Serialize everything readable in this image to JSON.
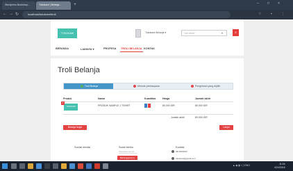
{
  "browser": {
    "tabs": [
      {
        "label": "Wordpress Bootstrap..."
      },
      {
        "label": "Tokokami | Belanja..."
      }
    ],
    "url": "localhost/tokokami/troli",
    "bookmarks": [
      "Apps",
      "Bookmarks"
    ]
  },
  "header": {
    "logo_text": "TOKOKAMI",
    "account_name": "Tokokami Belanja ▾",
    "search_placeholder": "Cari disini",
    "menu": [
      "BERANDA",
      "LAINNYA ▾",
      "PROFESA",
      "TROLI BELANJA",
      "KONTAK"
    ]
  },
  "cart": {
    "title": "Troli Belanja",
    "steps": [
      "Troli Belanja",
      "Metode pembayaran",
      "Pengiriman yang dipilih"
    ],
    "columns": [
      "Produk",
      "Nama",
      "Kuantitas",
      "Harga",
      "Jumlah akhir"
    ],
    "rows": [
      {
        "product_img_text": "TOKOKAMI",
        "name": "PRODUK SAMPLE 1 TSHIRT",
        "price": "80.000 IDR",
        "total": "80.000 IDR"
      }
    ],
    "total_label": "Jumlah akhir",
    "total_value": "80.000 IDR",
    "continue_button": "Belanja lanjut",
    "checkout_button": "Lanjut"
  },
  "footer": {
    "social_title": "Social media",
    "newsletter_title": "Surat berita",
    "newsletter_placeholder": "Masukkan Email",
    "newsletter_button": "Berlangganan ▸",
    "contact_title": "Kontak",
    "phone": "0813000000",
    "email": "tokokami@gmail.com"
  },
  "taskbar": {
    "time": "11:04",
    "date": "4/24/2018"
  },
  "colors": {
    "accent_red": "#e24242",
    "brand_teal": "#46c1b0",
    "step_active": "#4496c8"
  }
}
